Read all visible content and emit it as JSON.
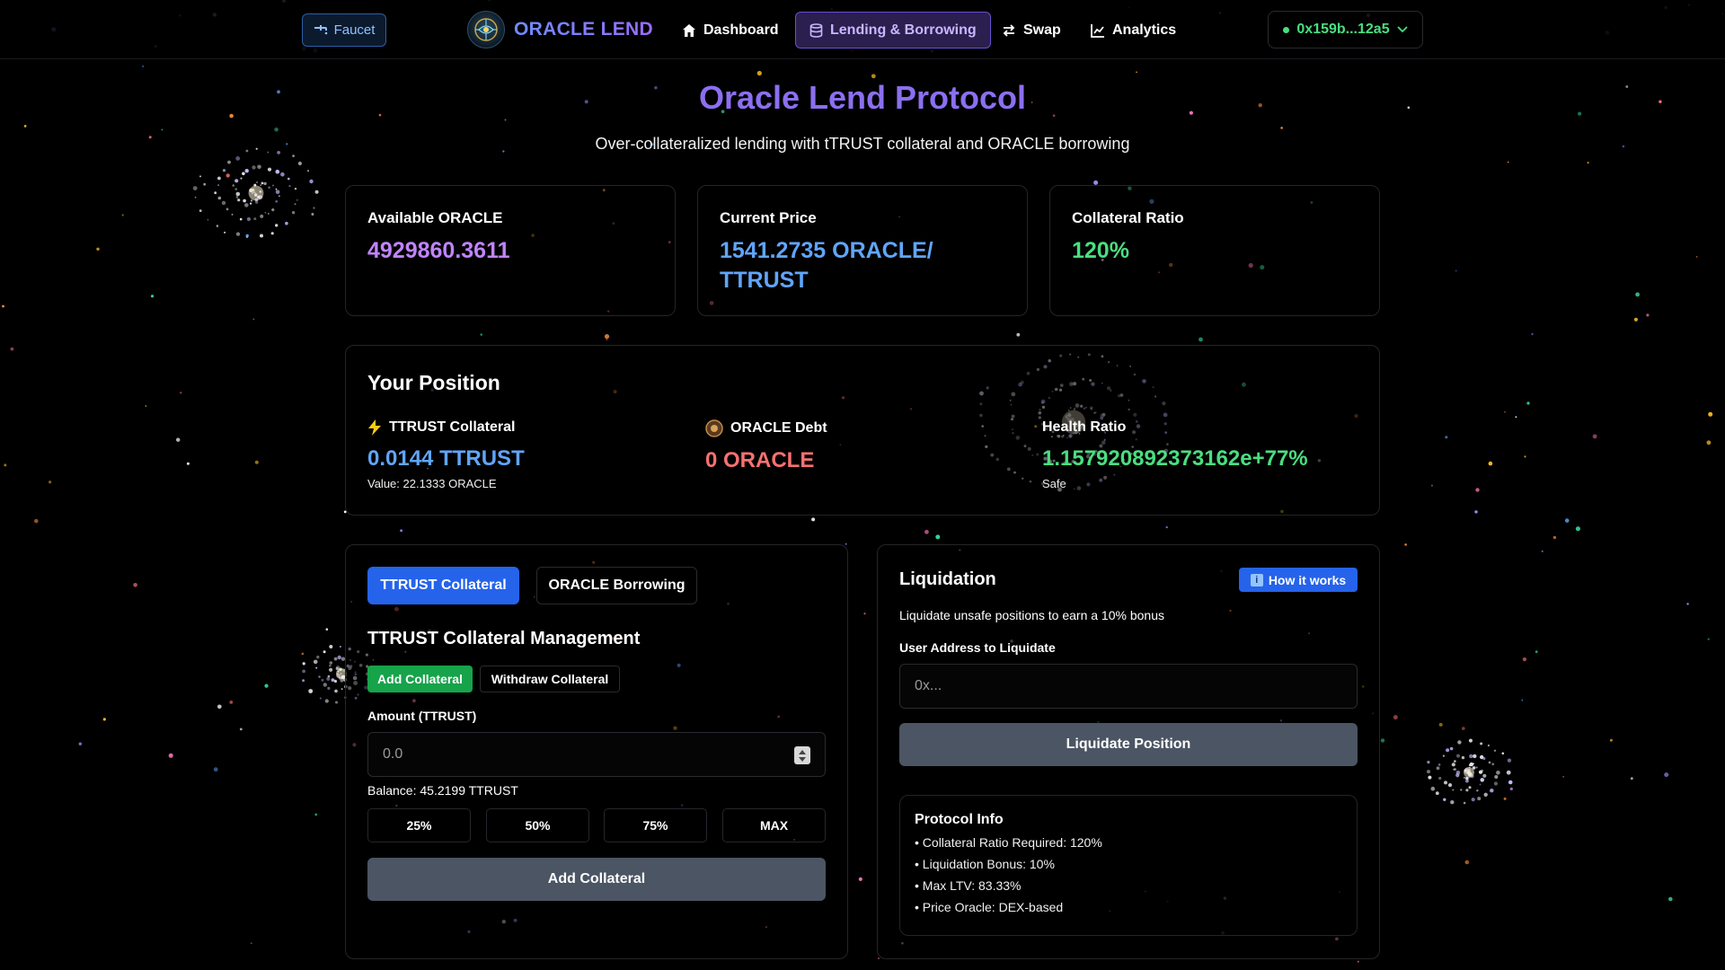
{
  "nav": {
    "faucet_label": "Faucet",
    "brand": "ORACLE LEND",
    "items": [
      {
        "label": "Dashboard",
        "icon": "home-icon"
      },
      {
        "label": "Lending & Borrowing",
        "icon": "coins-icon",
        "active": true
      },
      {
        "label": "Swap",
        "icon": "swap-icon"
      },
      {
        "label": "Analytics",
        "icon": "chart-icon"
      }
    ],
    "wallet": "0x159b...12a5"
  },
  "hero": {
    "title": "Oracle Lend Protocol",
    "subtitle": "Over-collateralized lending with tTRUST collateral and ORACLE borrowing"
  },
  "stats": [
    {
      "label": "Available ORACLE",
      "value": "4929860.3611",
      "color": "#c084fc"
    },
    {
      "label": "Current Price",
      "value": "1541.2735 ORACLE/\nTTRUST",
      "color": "#60a5fa"
    },
    {
      "label": "Collateral Ratio",
      "value": "120%",
      "color": "#4ade80"
    }
  ],
  "position": {
    "title": "Your Position",
    "collateral_label": "TTRUST Collateral",
    "collateral_value": "0.0144 TTRUST",
    "collateral_sub": "Value: 22.1333 ORACLE",
    "debt_label": "ORACLE Debt",
    "debt_value": "0 ORACLE",
    "health_label": "Health Ratio",
    "health_value": "1.157920892373162e+77%",
    "health_status": "Safe"
  },
  "manage": {
    "tab_collateral": "TTRUST Collateral",
    "tab_borrowing": "ORACLE Borrowing",
    "title": "TTRUST Collateral Management",
    "add_tab": "Add Collateral",
    "withdraw_tab": "Withdraw Collateral",
    "amount_label": "Amount (TTRUST)",
    "amount_placeholder": "0.0",
    "balance": "Balance: 45.2199 TTRUST",
    "pcts": [
      "25%",
      "50%",
      "75%",
      "MAX"
    ],
    "submit": "Add Collateral"
  },
  "liquidation": {
    "title": "Liquidation",
    "how_label": "How it works",
    "desc": "Liquidate unsafe positions to earn a 10% bonus",
    "address_label": "User Address to Liquidate",
    "address_placeholder": "0x...",
    "button": "Liquidate Position",
    "info_title": "Protocol Info",
    "info": [
      "• Collateral Ratio Required: 120%",
      "• Liquidation Bonus: 10%",
      "• Max LTV: 83.33%",
      "• Price Oracle: DEX-based"
    ]
  }
}
